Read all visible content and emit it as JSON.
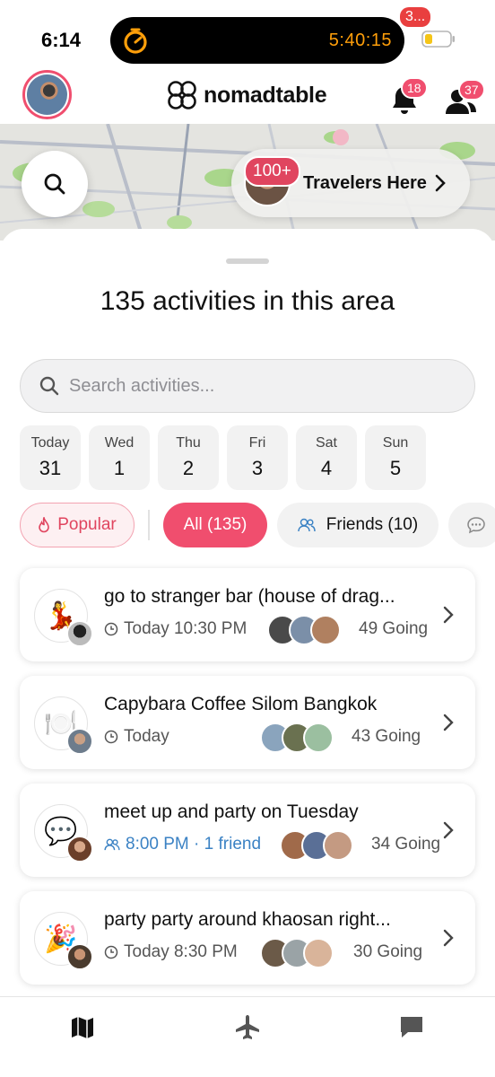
{
  "status_bar": {
    "time": "6:14",
    "timer": "5:40:15",
    "timer_icon": "stopwatch-icon",
    "battery_icon": "battery-low-icon"
  },
  "header": {
    "app_name": "nomadtable",
    "notifications_badge": "18",
    "friends_badge": "37",
    "brand_color": "#f04e6e"
  },
  "map": {
    "travelers_count": "100+",
    "travelers_label": "Travelers Here"
  },
  "sheet": {
    "title": "135 activities in this area",
    "search_placeholder": "Search activities..."
  },
  "days": [
    {
      "name": "Today",
      "num": "31"
    },
    {
      "name": "Wed",
      "num": "1"
    },
    {
      "name": "Thu",
      "num": "2"
    },
    {
      "name": "Fri",
      "num": "3"
    },
    {
      "name": "Sat",
      "num": "4"
    },
    {
      "name": "Sun",
      "num": "5"
    }
  ],
  "filters": {
    "popular": "Popular",
    "all": "All (135)",
    "friends": "Friends (10)"
  },
  "activities": [
    {
      "icon": "💃",
      "title": "go to stranger bar (house of drag...",
      "time": "Today 10:30 PM",
      "going": "49 Going"
    },
    {
      "icon": "🍽️",
      "title": "Capybara Coffee Silom Bangkok",
      "time": "Today",
      "going": "43 Going"
    },
    {
      "icon": "💬",
      "title": "meet up and party on Tuesday",
      "time": "8:00 PM · 1 friend",
      "going": "34 Going"
    },
    {
      "icon": "🎉",
      "title": "party party around khaosan right...",
      "time": "Today 8:30 PM",
      "going": "30 Going"
    }
  ],
  "bottom_nav": {
    "chat_badge": "3..."
  }
}
